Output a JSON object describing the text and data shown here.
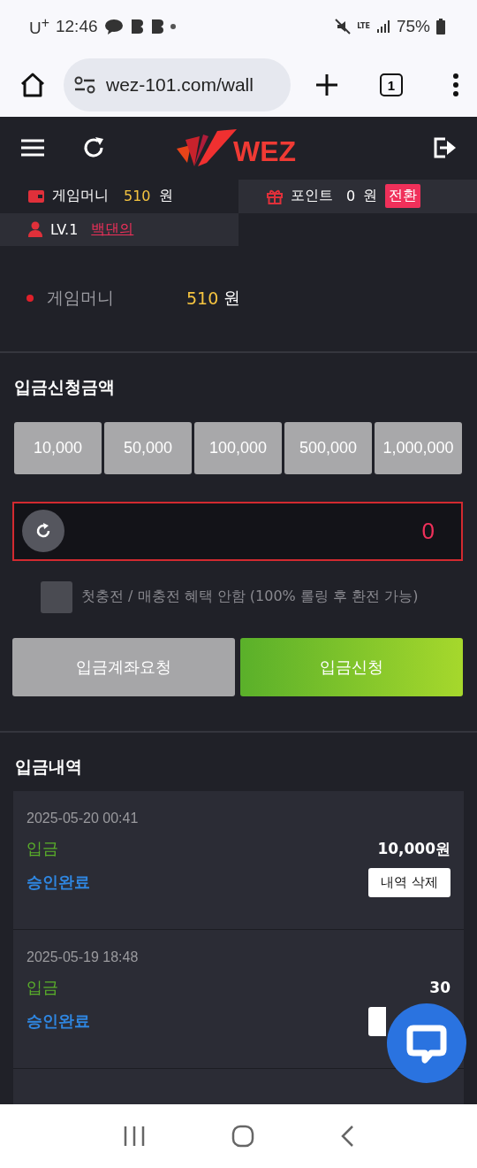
{
  "status_bar": {
    "carrier": "U$^{+}$",
    "time": "12:46",
    "network": "LTE",
    "battery": "75%"
  },
  "browser": {
    "url": "wez-101.com/wall",
    "tab_count": "1"
  },
  "header": {
    "logo_text": "WEZ"
  },
  "account": {
    "game_money_label": "게임머니",
    "game_money_value": "510",
    "game_money_unit": "원",
    "points_label": "포인트",
    "points_value": "0",
    "points_unit": "원",
    "convert_button": "전환",
    "level": "LV.1",
    "username": "백댄의"
  },
  "balance": {
    "label": "게임머니",
    "value": "510",
    "unit": "원"
  },
  "deposit": {
    "title": "입금신청금액",
    "presets": [
      "10,000",
      "50,000",
      "100,000",
      "500,000",
      "1,000,000"
    ],
    "amount": "0",
    "bonus_opt_out": {
      "label": "첫충전 / 매충전 혜택 안함 (100% 롤링 후 환전 가능)",
      "checked": false
    },
    "buttons": [
      {
        "label": "입금계좌요청",
        "kind": "secondary"
      },
      {
        "label": "입금신청",
        "kind": "primary"
      }
    ]
  },
  "history": {
    "title": "입금내역",
    "records": [
      {
        "datetime": "2025-05-20 00:41",
        "type": "입금",
        "amount": "10,000원",
        "status": "승인완료",
        "delete_button": "내역 삭제"
      },
      {
        "datetime": "2025-05-19 18:48",
        "type": "입금",
        "amount": "30",
        "status": "승인완료"
      }
    ]
  }
}
